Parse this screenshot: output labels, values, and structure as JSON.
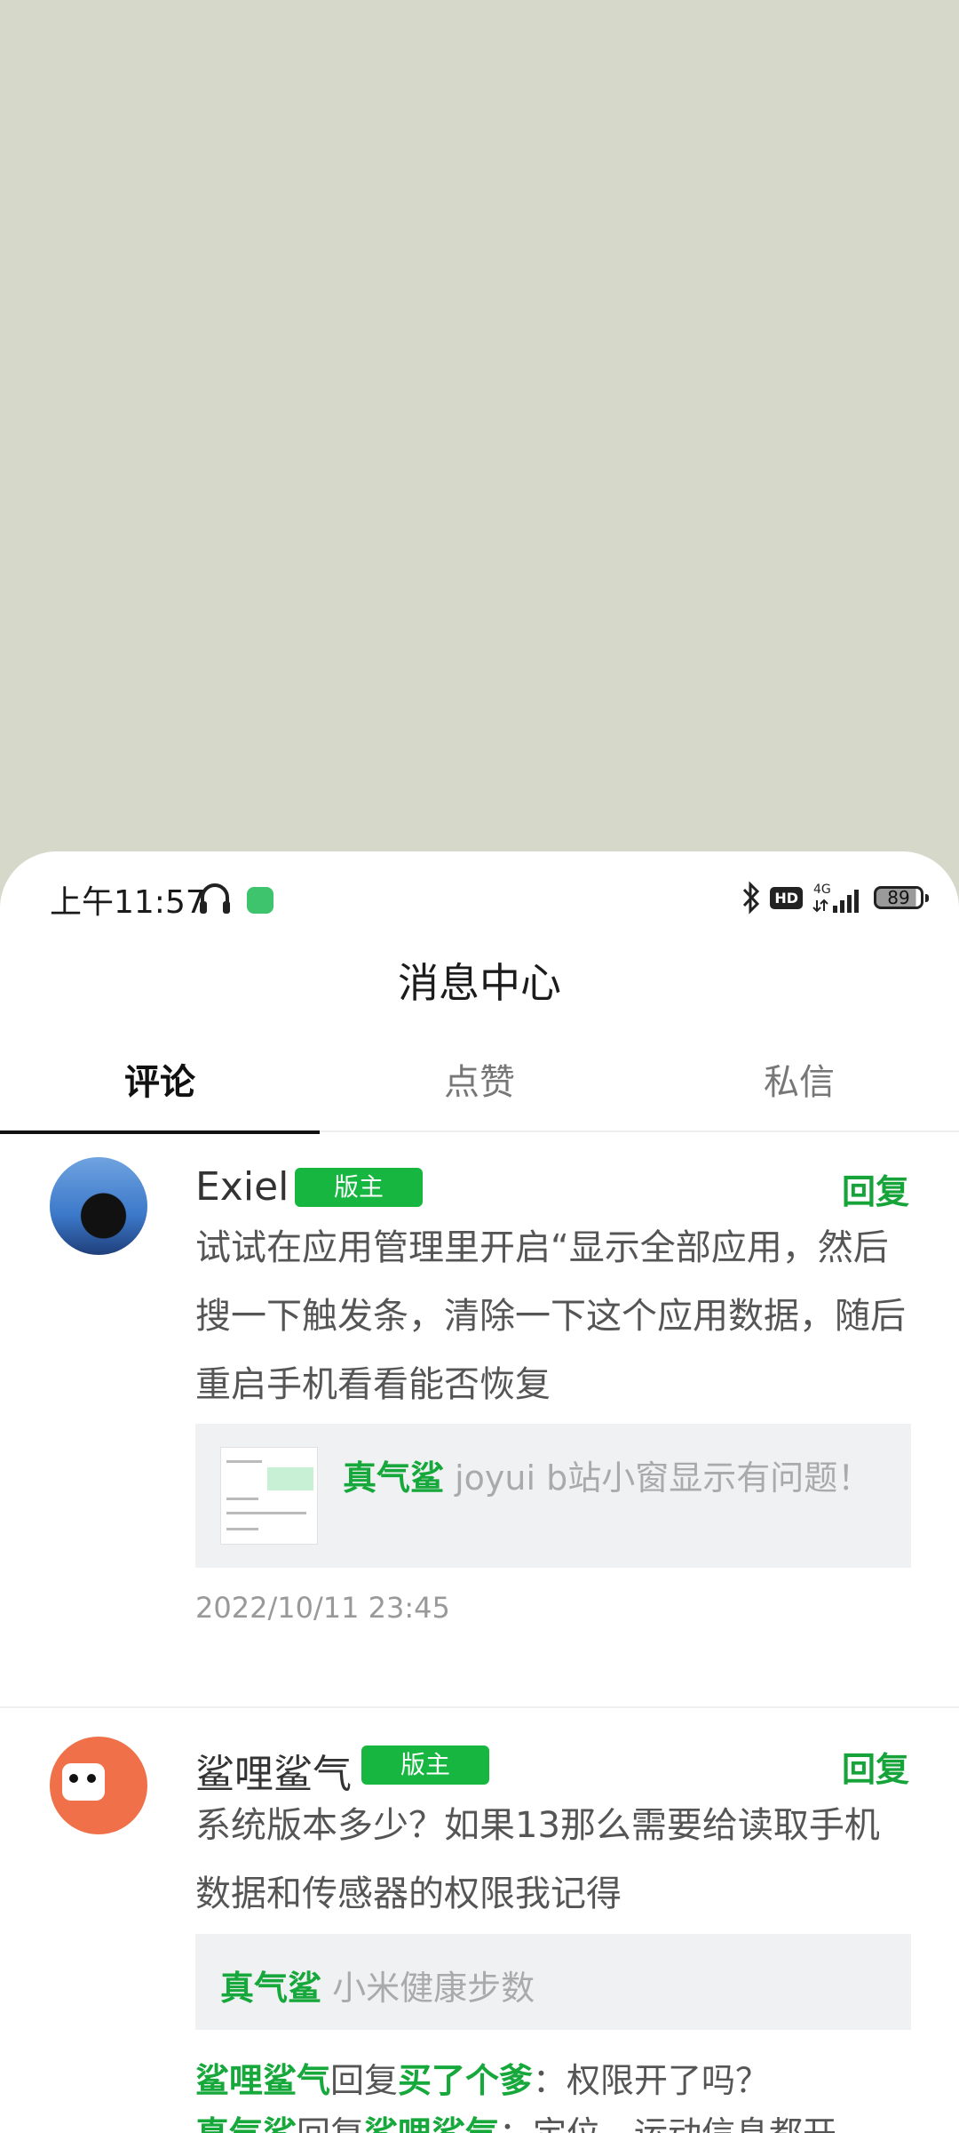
{
  "status_bar": {
    "time": "上午11:57",
    "network": "4G",
    "battery": "89"
  },
  "header": {
    "title": "消息中心"
  },
  "tabs": [
    {
      "label": "评论",
      "active": true
    },
    {
      "label": "点赞",
      "active": false
    },
    {
      "label": "私信",
      "active": false
    }
  ],
  "comments": [
    {
      "username": "Exiel",
      "badge": "版主",
      "reply_label": "回复",
      "text": "试试在应用管理里开启“显示全部应用，然后搜一下触发条，清除一下这个应用数据，随后重启手机看看能否恢复",
      "quote": {
        "name": "真气鲨",
        "text": " joyui b站小窗显示有问题！"
      },
      "timestamp": "2022/10/11 23:45"
    },
    {
      "username": "鲨哩鲨气",
      "badge": "版主",
      "reply_label": "回复",
      "text": "系统版本多少？如果13那么需要给读取手机数据和传感器的权限我记得",
      "quote": {
        "name": "真气鲨",
        "text": "  小米健康步数"
      },
      "sub_replies": [
        {
          "from": "鲨哩鲨气",
          "verb": "回复",
          "to": "买了个爹",
          "text": "：权限开了吗？"
        },
        {
          "from": "真气鲨",
          "verb": "回复",
          "to": "鲨哩鲨气",
          "text": "：定位，运动信息都开"
        }
      ]
    }
  ]
}
